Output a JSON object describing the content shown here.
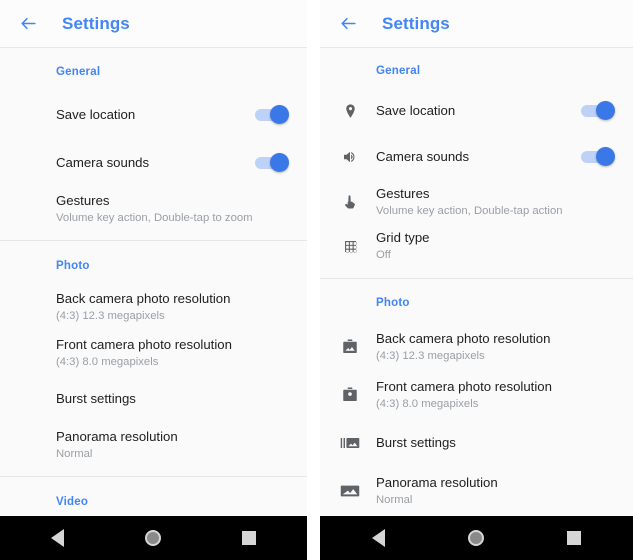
{
  "appbar": {
    "title": "Settings",
    "back_icon": "arrow-left-icon",
    "accent_color": "#4285f4"
  },
  "navbar": {
    "back_label": "Back",
    "home_label": "Home",
    "recents_label": "Recents",
    "background": "#000000"
  },
  "toggle": {
    "on_track_color": "#bed1f7",
    "on_thumb_color": "#3b78e7"
  },
  "left_panel": {
    "sections": [
      {
        "header": "General",
        "items": [
          {
            "title": "Save location",
            "subtitle": "",
            "control": "switch",
            "checked": true
          },
          {
            "title": "Camera sounds",
            "subtitle": "",
            "control": "switch",
            "checked": true
          },
          {
            "title": "Gestures",
            "subtitle": "Volume key action, Double-tap to zoom",
            "control": "none"
          }
        ]
      },
      {
        "header": "Photo",
        "items": [
          {
            "title": "Back camera photo resolution",
            "subtitle": "(4:3) 12.3 megapixels",
            "control": "none"
          },
          {
            "title": "Front camera photo resolution",
            "subtitle": "(4:3) 8.0 megapixels",
            "control": "none"
          },
          {
            "title": "Burst settings",
            "subtitle": "",
            "control": "none"
          },
          {
            "title": "Panorama resolution",
            "subtitle": "Normal",
            "control": "none"
          }
        ]
      },
      {
        "header": "Video",
        "items": []
      }
    ]
  },
  "right_panel": {
    "sections": [
      {
        "header": "General",
        "items": [
          {
            "icon": "location-pin-icon",
            "title": "Save location",
            "subtitle": "",
            "control": "switch",
            "checked": true
          },
          {
            "icon": "speaker-icon",
            "title": "Camera sounds",
            "subtitle": "",
            "control": "switch",
            "checked": true
          },
          {
            "icon": "touch-gesture-icon",
            "title": "Gestures",
            "subtitle": "Volume key action, Double-tap action",
            "control": "none"
          },
          {
            "icon": "grid-icon",
            "title": "Grid type",
            "subtitle": "Off",
            "control": "none"
          }
        ]
      },
      {
        "header": "Photo",
        "items": [
          {
            "icon": "back-camera-photo-icon",
            "title": "Back camera photo resolution",
            "subtitle": "(4:3) 12.3 megapixels",
            "control": "none"
          },
          {
            "icon": "front-camera-photo-icon",
            "title": "Front camera photo resolution",
            "subtitle": "(4:3) 8.0 megapixels",
            "control": "none"
          },
          {
            "icon": "burst-photo-icon",
            "title": "Burst settings",
            "subtitle": "",
            "control": "none"
          },
          {
            "icon": "panorama-photo-icon",
            "title": "Panorama resolution",
            "subtitle": "Normal",
            "control": "none"
          }
        ]
      }
    ]
  }
}
